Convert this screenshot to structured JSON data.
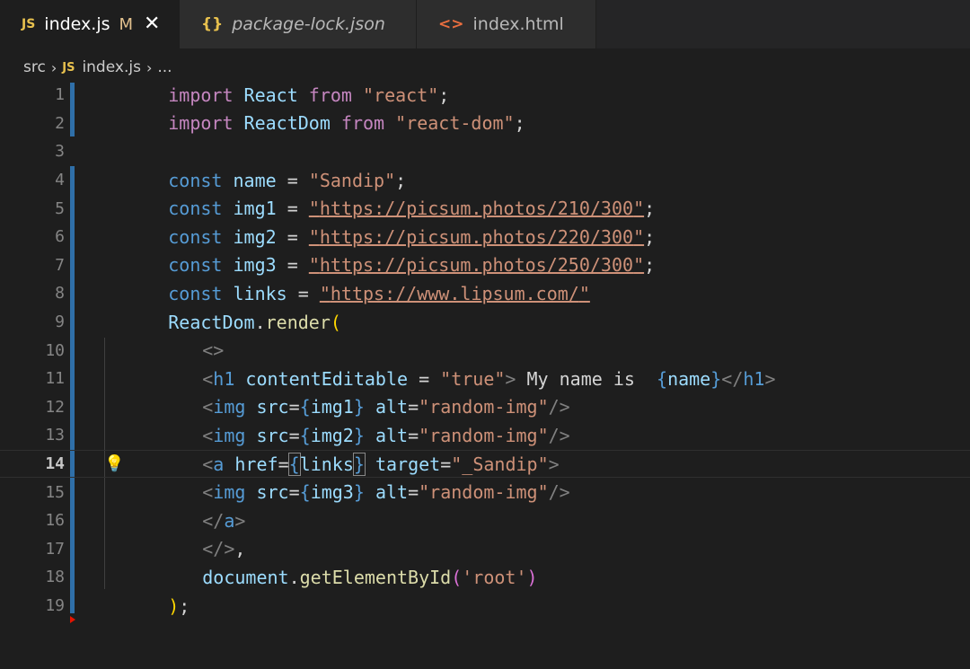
{
  "tabs": [
    {
      "icon": "JS",
      "label": "index.js",
      "modified": "M",
      "close": "✕"
    },
    {
      "icon": "{}",
      "label": "package-lock.json"
    },
    {
      "icon": "<>",
      "label": "index.html"
    }
  ],
  "breadcrumb": {
    "folder": "src",
    "file_icon": "JS",
    "file": "index.js",
    "more": "..."
  },
  "editor": {
    "current_line": 14,
    "line_numbers": [
      "1",
      "2",
      "3",
      "4",
      "5",
      "6",
      "7",
      "8",
      "9",
      "10",
      "11",
      "12",
      "13",
      "14",
      "15",
      "16",
      "17",
      "18",
      "19"
    ]
  },
  "code": {
    "l1": {
      "kw": "import",
      "id": " React ",
      "from": "from",
      "str": " \"react\"",
      "end": ";"
    },
    "l2": {
      "kw": "import",
      "id": " ReactDom ",
      "from": "from",
      "str": " \"react-dom\"",
      "end": ";"
    },
    "l4": {
      "kw": "const",
      "name": " name",
      "eq": " = ",
      "str": "\"Sandip\"",
      "end": ";"
    },
    "l5": {
      "kw": "const",
      "name": " img1",
      "eq": " = ",
      "q1": "\"",
      "url": "https://picsum.photos/210/300",
      "q2": "\"",
      "end": ";"
    },
    "l6": {
      "kw": "const",
      "name": " img2",
      "eq": " = ",
      "q1": "\"",
      "url": "https://picsum.photos/220/300",
      "q2": "\"",
      "end": ";"
    },
    "l7": {
      "kw": "const",
      "name": " img3",
      "eq": " = ",
      "q1": "\"",
      "url": "https://picsum.photos/250/300",
      "q2": "\"",
      "end": ";"
    },
    "l8": {
      "kw": "const",
      "name": " links",
      "eq": " = ",
      "q1": "\"",
      "url": "https://www.lipsum.com/",
      "q2": "\""
    },
    "l9": {
      "obj": "ReactDom",
      "dot": ".",
      "fn": "render",
      "paren": "("
    },
    "l10": {
      "frag": "<>"
    },
    "l11": {
      "open": "<",
      "tag": "h1",
      "attr": " contentEditable",
      "eq": " = ",
      "val": "\"true\"",
      "close": ">",
      "text": " My name is  ",
      "b1": "{",
      "expr": "name",
      "b2": "}",
      "end1": "</",
      "tag2": "h1",
      "end2": ">"
    },
    "l12": {
      "open": "<",
      "tag": "img",
      "attr": " src",
      "eq": "=",
      "b1": "{",
      "expr": "img1",
      "b2": "}",
      "attr2": " alt",
      "eq2": "=",
      "val": "\"random-img\"",
      "close": "/>"
    },
    "l13": {
      "open": "<",
      "tag": "img",
      "attr": " src",
      "eq": "=",
      "b1": "{",
      "expr": "img2",
      "b2": "}",
      "attr2": " alt",
      "eq2": "=",
      "val": "\"random-img\"",
      "close": "/>"
    },
    "l14": {
      "open": "<",
      "tag": "a",
      "attr": " href",
      "eq": "=",
      "b1": "{",
      "expr": "links",
      "b2": "}",
      "attr2": " target",
      "eq2": "=",
      "val": "\"_Sandip\"",
      "close": ">"
    },
    "l15": {
      "open": "<",
      "tag": "img",
      "attr": " src",
      "eq": "=",
      "b1": "{",
      "expr": "img3",
      "b2": "}",
      "attr2": " alt",
      "eq2": "=",
      "val": "\"random-img\"",
      "close": "/>"
    },
    "l16": {
      "open": "</",
      "tag": "a",
      "close": ">"
    },
    "l17": {
      "frag": "</>",
      "comma": ","
    },
    "l18": {
      "obj": "document",
      "dot": ".",
      "fn": "getElementById",
      "p1": "(",
      "str": "'root'",
      "p2": ")"
    },
    "l19": {
      "paren": ")",
      "end": ";"
    }
  }
}
